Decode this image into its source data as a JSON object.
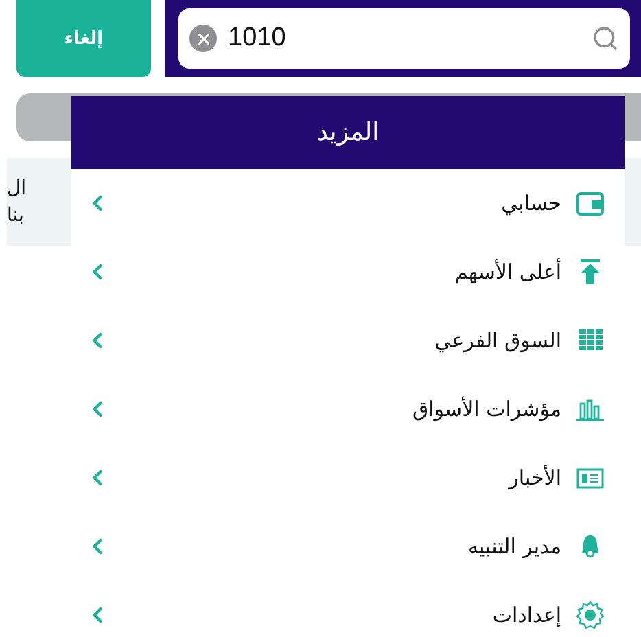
{
  "search": {
    "value": "1010"
  },
  "cancel_button": "إلغاء",
  "background_row": {
    "lines": [
      "ال",
      "بنا"
    ]
  },
  "menu": {
    "title": "المزيد",
    "items": [
      {
        "kind": "wallet",
        "label": "حسابي"
      },
      {
        "kind": "top",
        "label": "أعلى الأسهم"
      },
      {
        "kind": "table",
        "label": "السوق الفرعي"
      },
      {
        "kind": "bars",
        "label": "مؤشرات الأسواق"
      },
      {
        "kind": "news",
        "label": "الأخبار"
      },
      {
        "kind": "bell",
        "label": "مدير التنبيه"
      },
      {
        "kind": "gear",
        "label": "إعدادات"
      }
    ]
  }
}
